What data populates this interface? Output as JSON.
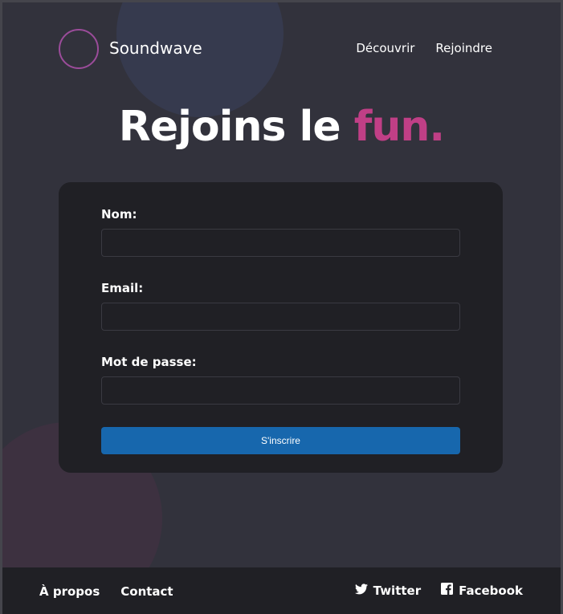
{
  "header": {
    "brand": "Soundwave",
    "logo_icon": "soundwave-icon",
    "nav": [
      {
        "label": "Découvrir"
      },
      {
        "label": "Rejoindre"
      }
    ]
  },
  "hero": {
    "title_main": "Rejoins le",
    "title_accent": "fun.",
    "accent_color": "#c03f86"
  },
  "form": {
    "fields": [
      {
        "label": "Nom:",
        "value": ""
      },
      {
        "label": "Email:",
        "value": ""
      },
      {
        "label": "Mot de passe:",
        "value": ""
      }
    ],
    "submit_label": "S'inscrire",
    "submit_color": "#1767ad"
  },
  "footer": {
    "links": [
      {
        "label": "À propos"
      },
      {
        "label": "Contact"
      }
    ],
    "social": [
      {
        "label": "Twitter",
        "icon": "twitter-icon"
      },
      {
        "label": "Facebook",
        "icon": "facebook-icon"
      }
    ]
  }
}
